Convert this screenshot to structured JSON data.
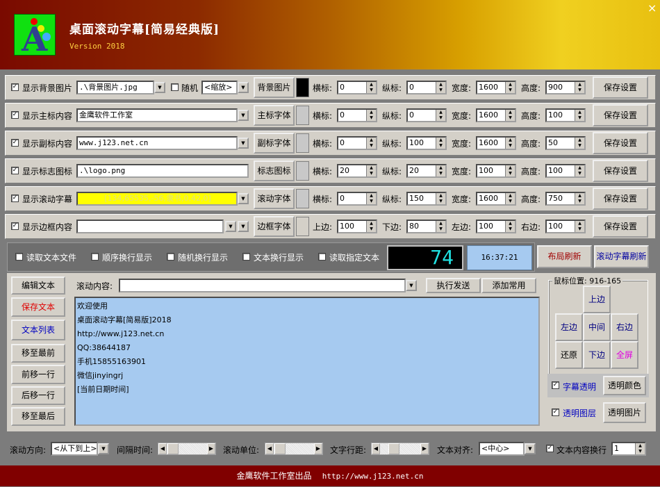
{
  "header": {
    "title": "桌面滚动字幕[简易经典版]",
    "version": "Version 2018",
    "close": "×",
    "logo_text": "A"
  },
  "rows": [
    {
      "check": "显示背景图片",
      "value": ".\\背景图片.jpg",
      "type": "combo-short",
      "random_label": "随机",
      "mode": "<缩放>",
      "button": "背景图片",
      "swatch": "#000000",
      "labels": [
        "横标:",
        "纵标:",
        "宽度:",
        "高度:"
      ],
      "vals": [
        "0",
        "0",
        "1600",
        "900"
      ],
      "save": "保存设置"
    },
    {
      "check": "显示主标内容",
      "value": "金鹰软件工作室",
      "type": "combo",
      "button": "主标字体",
      "swatch": "#c8c8c8",
      "labels": [
        "横标:",
        "纵标:",
        "宽度:",
        "高度:"
      ],
      "vals": [
        "0",
        "0",
        "1600",
        "100"
      ],
      "save": "保存设置"
    },
    {
      "check": "显示副标内容",
      "value": "www.j123.net.cn",
      "type": "combo",
      "button": "副标字体",
      "swatch": "#c8c8c8",
      "labels": [
        "横标:",
        "纵标:",
        "宽度:",
        "高度:"
      ],
      "vals": [
        "0",
        "100",
        "1600",
        "50"
      ],
      "save": "保存设置"
    },
    {
      "check": "显示标志图标",
      "value": ".\\logo.png",
      "type": "text",
      "button": "标志图标",
      "swatch": "#c8c8c8",
      "labels": [
        "横标:",
        "纵标:",
        "宽度:",
        "高度:"
      ],
      "vals": [
        "20",
        "20",
        "100",
        "100"
      ],
      "save": "保存设置"
    },
    {
      "check": "显示滚动字幕",
      "value": "[134,65535,-56,隶书,0,42,0]",
      "type": "combo-yellow",
      "button": "滚动字体",
      "swatch": "#c8c8c8",
      "labels": [
        "横标:",
        "纵标:",
        "宽度:",
        "高度:"
      ],
      "vals": [
        "0",
        "150",
        "1600",
        "750"
      ],
      "save": "保存设置"
    },
    {
      "check": "显示边框内容",
      "value": "",
      "type": "combo-double",
      "button": "边框字体",
      "swatch": "#d4d0c8",
      "labels": [
        "上边:",
        "下边:",
        "左边:",
        "右边:"
      ],
      "vals": [
        "100",
        "80",
        "100",
        "100"
      ],
      "save": "保存设置"
    }
  ],
  "midbar": {
    "options": [
      "读取文本文件",
      "顺序换行显示",
      "随机换行显示",
      "文本换行显示",
      "读取指定文本"
    ],
    "counter": "74",
    "time": "16:37:21",
    "layout_refresh": "布局刷新",
    "scroll_refresh": "滚动字幕刷新"
  },
  "left_buttons": [
    "编辑文本",
    "保存文本",
    "文本列表",
    "移至最前",
    "前移一行",
    "后移一行",
    "移至最后"
  ],
  "content": {
    "label": "滚动内容:",
    "value": "",
    "send": "执行发送",
    "add": "添加常用",
    "lines": [
      "欢迎使用",
      "桌面滚动字幕[简易版]2018",
      "http://www.j123.net.cn",
      "QQ:38644187",
      "手机15855163901",
      "微信jinyingrj",
      "[当前日期时间]"
    ]
  },
  "position": {
    "legend": "鼠标位置: 916-165",
    "top": "上边",
    "left": "左边",
    "middle": "中间",
    "right": "右边",
    "restore": "还原",
    "bottom": "下边",
    "full": "全屏",
    "subtitle_transparent": "字幕透明",
    "transparent_color": "透明颜色",
    "transparent_layer": "透明图层",
    "transparent_image": "透明图片"
  },
  "bottom": {
    "direction_label": "滚动方向:",
    "direction": "<从下到上>",
    "interval_label": "间隔时间:",
    "unit_label": "滚动单位:",
    "spacing_label": "文字行距:",
    "align_label": "文本对齐:",
    "align": "<中心>",
    "wrap_label": "文本内容换行",
    "wrap_value": "1"
  },
  "footer": {
    "text": "金鹰软件工作室出品",
    "url": "http://www.j123.net.cn"
  }
}
